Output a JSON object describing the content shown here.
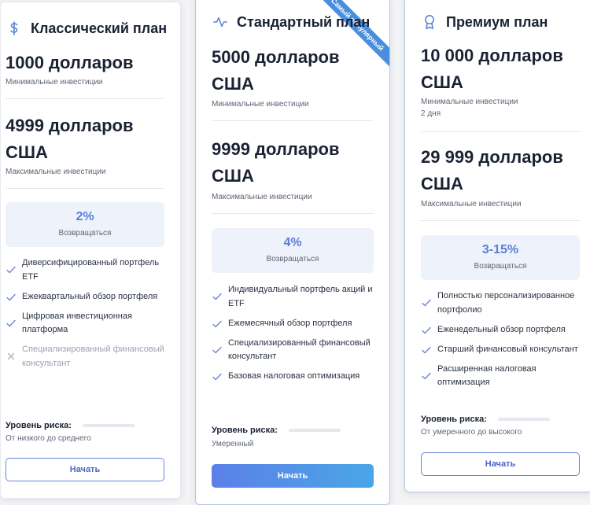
{
  "colors": {
    "accent": "#5a7fd6",
    "check": "#6c86d1",
    "disabled": "#aab1bf",
    "button_gradient_start": "#5b80e8",
    "button_gradient_end": "#4aa6e6"
  },
  "plans": {
    "classic": {
      "icon": "dollar-icon",
      "title": "Классический план",
      "min_amount": "1000 долларов",
      "min_label": "Минимальные инвестиции",
      "max_amount_line1": "4999 долларов",
      "max_amount_line2": "США",
      "max_label": "Максимальные инвестиции",
      "return_value": "2%",
      "return_label": "Возвращаться",
      "features": [
        {
          "text": "Диверсифицированный портфель ETF",
          "included": true
        },
        {
          "text": "Ежеквартальный обзор портфеля",
          "included": true
        },
        {
          "text": "Цифровая инвестиционная платформа",
          "included": true
        },
        {
          "text": "Специализированный финансовый консультант",
          "included": false
        }
      ],
      "risk_label": "Уровень риска:",
      "risk_text": "От низкого до среднего",
      "button": "Начать"
    },
    "standard": {
      "icon": "activity-icon",
      "title": "Стандартный план",
      "ribbon": "Самый популярный",
      "min_amount_line1": "5000 долларов",
      "min_amount_line2": "США",
      "min_label": "Минимальные инвестиции",
      "max_amount_line1": "9999 долларов",
      "max_amount_line2": "США",
      "max_label": "Максимальные инвестиции",
      "return_value": "4%",
      "return_label": "Возвращаться",
      "features": [
        {
          "text": "Индивидуальный портфель акций и ETF",
          "included": true
        },
        {
          "text": "Ежемесячный обзор портфеля",
          "included": true
        },
        {
          "text": "Специализированный финансовый консультант",
          "included": true
        },
        {
          "text": "Базовая налоговая оптимизация",
          "included": true
        }
      ],
      "risk_label": "Уровень риска:",
      "risk_text": "Умеренный",
      "button": "Начать"
    },
    "premium": {
      "icon": "award-icon",
      "title": "Премиум план",
      "min_amount_line1": "10 000 долларов",
      "min_amount_line2": "США",
      "min_label": "Минимальные инвестиции",
      "min_note": "2 дня",
      "max_amount_line1": "29 999 долларов",
      "max_amount_line2": "США",
      "max_label": "Максимальные инвестиции",
      "return_value": "3-15%",
      "return_label": "Возвращаться",
      "features": [
        {
          "text": "Полностью персонализированное портфолио",
          "included": true
        },
        {
          "text": "Еженедельный обзор портфеля",
          "included": true
        },
        {
          "text": "Старший финансовый консультант",
          "included": true
        },
        {
          "text": "Расширенная налоговая оптимизация",
          "included": true
        }
      ],
      "risk_label": "Уровень риска:",
      "risk_text": "От умеренного до высокого",
      "button": "Начать"
    }
  }
}
